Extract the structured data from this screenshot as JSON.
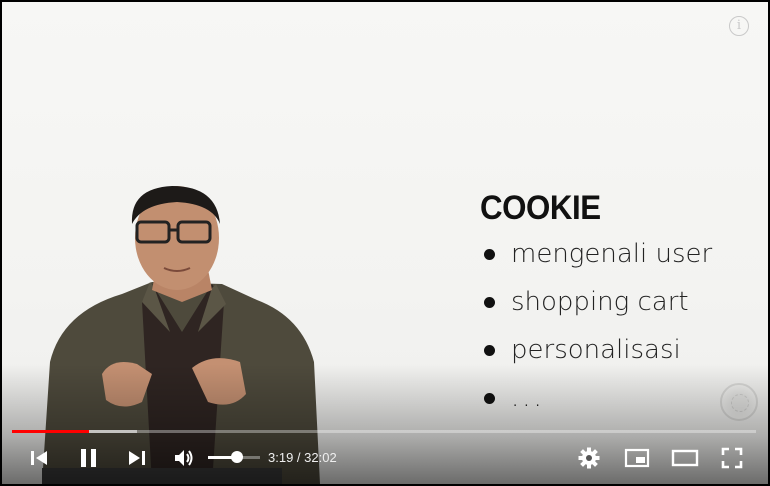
{
  "player": {
    "current_time": "3:19",
    "duration": "32:02",
    "time_display": "3:19 / 32:02",
    "progress_played_fraction": 0.1036,
    "progress_buffered_fraction": 0.168,
    "volume_fraction": 0.55,
    "state": "playing"
  },
  "slide": {
    "title": "COOKIE",
    "bullets": [
      "mengenali user",
      "shopping cart",
      "personalisasi",
      "..."
    ]
  },
  "icons": {
    "info": "info-icon",
    "previous": "skip-previous-icon",
    "pause": "pause-icon",
    "next": "skip-next-icon",
    "volume": "volume-icon",
    "settings": "gear-icon",
    "miniplayer": "miniplayer-icon",
    "theater": "theater-mode-icon",
    "fullscreen": "fullscreen-icon"
  },
  "info_glyph": "i",
  "colors": {
    "progress_played": "#ff0000",
    "controls": "#ffffff"
  }
}
